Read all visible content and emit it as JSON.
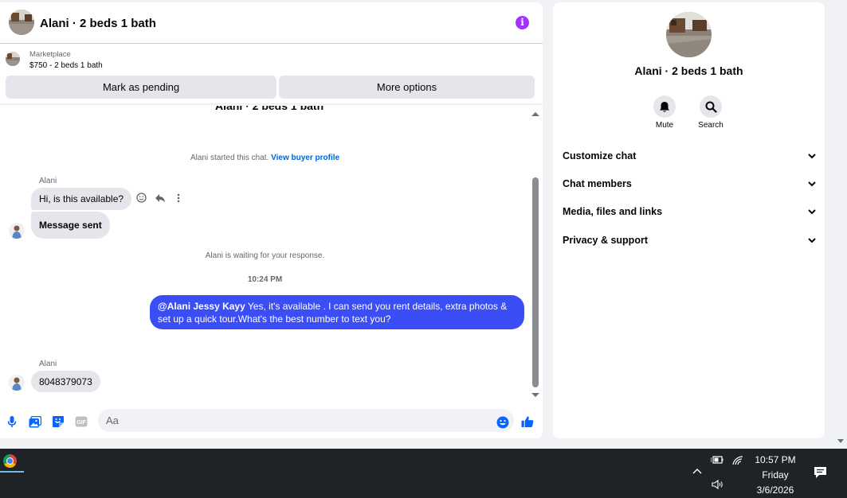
{
  "chat": {
    "title": "Alani · 2 beds 1 bath",
    "listing_source": "Marketplace",
    "listing_price": "$750 - 2 beds 1 bath",
    "mark_pending_label": "Mark as pending",
    "more_options_label": "More options",
    "scrolled_title": "Alani · 2 beds 1 bath",
    "started_text": "Alani started this chat.",
    "view_profile_link": "View buyer profile",
    "sender_name_1": "Alani",
    "message_1": "Hi, is this available?",
    "message_2": "Message sent",
    "waiting_text": "Alani is waiting for your response.",
    "timestamp": "10:24 PM",
    "outgoing_mention": "@Alani Jessy Kayy",
    "outgoing_text": " Yes, it's available .  I can send you rent details, extra photos & set up a quick tour.What's the best number to text you?",
    "sender_name_2": "Alani",
    "message_3": "8048379073",
    "input_placeholder": "Aa"
  },
  "info": {
    "title": "Alani · 2 beds 1 bath",
    "mute_label": "Mute",
    "search_label": "Search",
    "sections": [
      "Customize chat",
      "Chat members",
      "Media, files and links",
      "Privacy & support"
    ]
  },
  "taskbar": {
    "time": "10:57 PM",
    "day": "Friday",
    "date": "3/6/2026"
  },
  "colors": {
    "accent": "#3b4ef5",
    "info_purple": "#a033ff",
    "messenger_blue": "#0866ff"
  }
}
